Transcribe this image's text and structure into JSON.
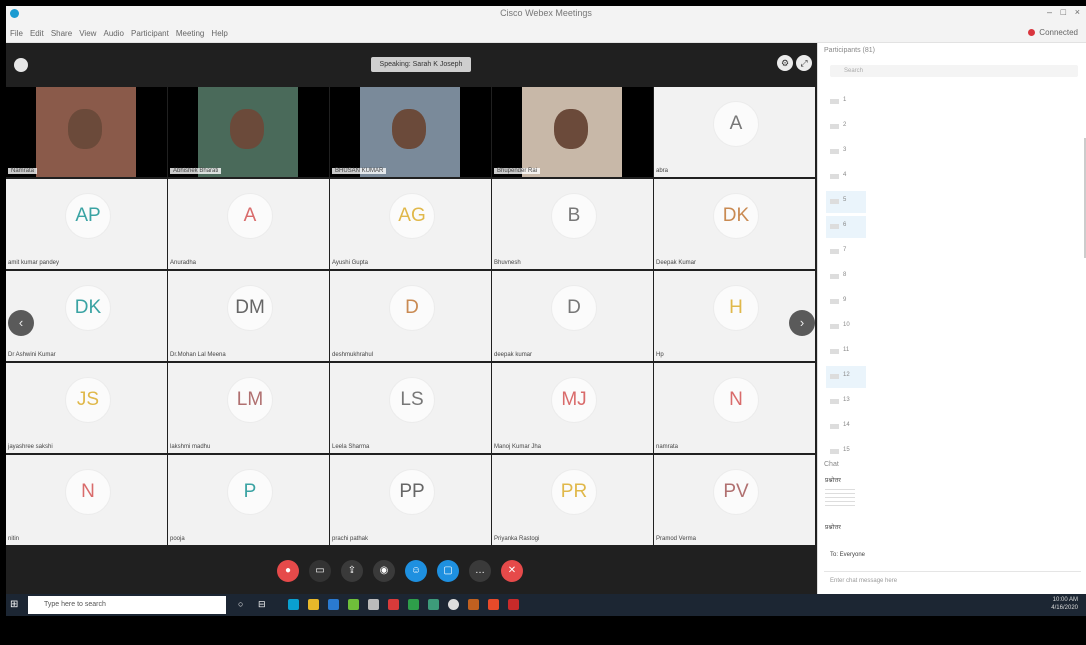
{
  "app": {
    "title": "Cisco Webex Meetings",
    "menu": [
      "File",
      "Edit",
      "Share",
      "View",
      "Audio",
      "Participant",
      "Meeting",
      "Help"
    ],
    "connectivity": "Connected",
    "window_controls": [
      "–",
      "□",
      "×"
    ]
  },
  "meeting": {
    "speaking": "Speaking: Sarah K Joseph"
  },
  "participants_tiles": [
    {
      "initials": "",
      "label": "Namrata",
      "video": true,
      "color": "#e07070"
    },
    {
      "initials": "",
      "label": "Abhishek Bharati",
      "video": true,
      "color": "#e07070"
    },
    {
      "initials": "",
      "label": "BHUSAN KUMAR",
      "video": true,
      "color": "#e07070"
    },
    {
      "initials": "",
      "label": "Bhupender Rai",
      "video": true,
      "color": "#e07070"
    },
    {
      "initials": "A",
      "label": "abra",
      "video": false,
      "color": "#777777"
    },
    {
      "initials": "AP",
      "label": "amit kumar pandey",
      "video": false,
      "color": "#3aa3a3"
    },
    {
      "initials": "A",
      "label": "Anuradha",
      "video": false,
      "color": "#d96b6b"
    },
    {
      "initials": "AG",
      "label": "Ayushi Gupta",
      "video": false,
      "color": "#e0b84a"
    },
    {
      "initials": "B",
      "label": "Bhuvnesh",
      "video": false,
      "color": "#777777"
    },
    {
      "initials": "DK",
      "label": "Deepak Kumar",
      "video": false,
      "color": "#c98a52"
    },
    {
      "initials": "DK",
      "label": "Dr Ashwini Kumar",
      "video": false,
      "color": "#3aa3a3"
    },
    {
      "initials": "DM",
      "label": "Dr.Mohan Lal Meena",
      "video": false,
      "color": "#666666"
    },
    {
      "initials": "D",
      "label": "deshmukhrahul",
      "video": false,
      "color": "#c98a52"
    },
    {
      "initials": "D",
      "label": "deepak kumar",
      "video": false,
      "color": "#777777"
    },
    {
      "initials": "H",
      "label": "Hp",
      "video": false,
      "color": "#e0b84a"
    },
    {
      "initials": "JS",
      "label": "jayashree sakshi",
      "video": false,
      "color": "#e0b84a"
    },
    {
      "initials": "LM",
      "label": "lakshmi madhu",
      "video": false,
      "color": "#b07070"
    },
    {
      "initials": "LS",
      "label": "Leela Sharma",
      "video": false,
      "color": "#777777"
    },
    {
      "initials": "MJ",
      "label": "Manoj Kumar Jha",
      "video": false,
      "color": "#d96b6b"
    },
    {
      "initials": "N",
      "label": "namrata",
      "video": false,
      "color": "#d96b6b"
    },
    {
      "initials": "N",
      "label": "nitin",
      "video": false,
      "color": "#d96b6b"
    },
    {
      "initials": "P",
      "label": "pooja",
      "video": false,
      "color": "#3aa3a3"
    },
    {
      "initials": "PP",
      "label": "prachi pathak",
      "video": false,
      "color": "#666666"
    },
    {
      "initials": "PR",
      "label": "Priyanka Rastogi",
      "video": false,
      "color": "#e0b84a"
    },
    {
      "initials": "PV",
      "label": "Pramod Verma",
      "video": false,
      "color": "#b07070"
    }
  ],
  "panel": {
    "title": "Participants (81)",
    "search_placeholder": "Search",
    "rows": [
      "1",
      "2",
      "3",
      "4",
      "5",
      "6",
      "7",
      "8",
      "9",
      "10",
      "11",
      "12",
      "13",
      "14",
      "15"
    ],
    "chat_header": "Chat",
    "chat_messages": [
      "प्रश्नोत्तर",
      "प्रश्नोत्तर"
    ],
    "chat_to": "To: Everyone",
    "chat_placeholder": "Enter chat message here"
  },
  "taskbar": {
    "search_placeholder": "Type here to search",
    "time": "10:00 AM",
    "date": "4/16/2020"
  }
}
